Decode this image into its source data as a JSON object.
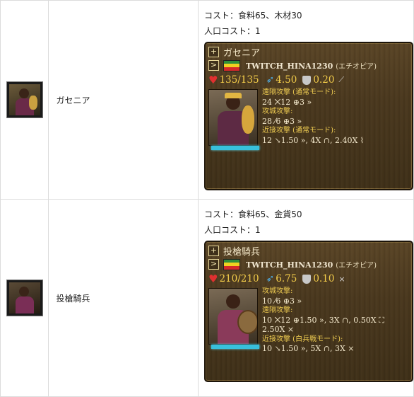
{
  "units": [
    {
      "name": "ガセニア",
      "cost": "コスト：食料65、木材30",
      "pop": "人口コスト：1",
      "card": {
        "title": "ガセニア",
        "player": "TWITCH_HINA1230",
        "civ": "(エチオピア)",
        "hp": "135/135",
        "speed": "4.50",
        "armor": "0.20",
        "attacks": [
          {
            "label": "遠隔攻撃 (通常モード):",
            "value": "24 ⨉12 ⊕3 »"
          },
          {
            "label": "攻城攻撃:",
            "value": "28 ⁄6 ⊕3 »"
          },
          {
            "label": "近接攻撃 (通常モード):",
            "value": "12 ↘1.50 », 4X ∩, 2.40X ⌇"
          }
        ]
      }
    },
    {
      "name": "投槍騎兵",
      "cost": "コスト：食料65、金貨50",
      "pop": "人口コスト：1",
      "card": {
        "title": "投槍騎兵",
        "player": "TWITCH_HINA1230",
        "civ": "(エチオピア)",
        "hp": "210/210",
        "speed": "6.75",
        "armor": "0.10",
        "attacks": [
          {
            "label": "攻城攻撃:",
            "value": "10 ⁄6 ⊕3 »"
          },
          {
            "label": "遠隔攻撃:",
            "value": "10 ⨉12 ⊕1.50 », 3X ∩, 0.50X ⛶"
          },
          {
            "label": "",
            "value": "2.50X ⨯"
          },
          {
            "label": "近接攻撃 (白兵戦モード):",
            "value": "10 ↘1.50 », 5X ∩, 3X ⨯"
          }
        ]
      }
    }
  ],
  "icons": {
    "add": "+",
    "expand": ">"
  },
  "flag_colors": [
    "#2f8f3a",
    "#f0d020",
    "#d42a2a"
  ]
}
